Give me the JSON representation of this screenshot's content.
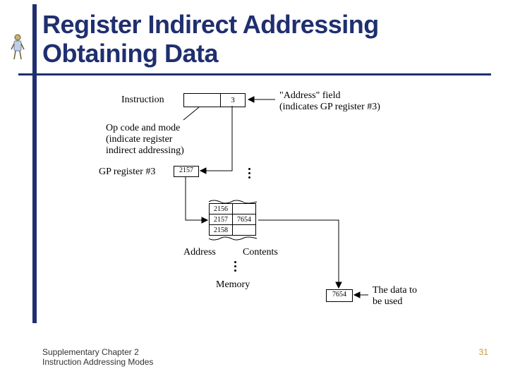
{
  "title_line1": "Register Indirect Addressing",
  "title_line2": "Obtaining Data",
  "footer": {
    "line1": "Supplementary Chapter 2",
    "line2": "Instruction Addressing Modes"
  },
  "page_number": "31",
  "diagram": {
    "instruction_label": "Instruction",
    "address_field_value": "3",
    "address_field_label1": "\"Address\" field",
    "address_field_label2": "(indicates GP register #3)",
    "opcode_label1": "Op code and mode",
    "opcode_label2": "(indicate register",
    "opcode_label3": "indirect addressing)",
    "gp_register_label": "GP register #3",
    "gp_register_value": "2157",
    "memory": {
      "rows": [
        {
          "addr": "2156",
          "val": ""
        },
        {
          "addr": "2157",
          "val": "7654"
        },
        {
          "addr": "2158",
          "val": ""
        }
      ],
      "addr_header": "Address",
      "contents_header": "Contents",
      "mem_label": "Memory"
    },
    "data_value": "7654",
    "data_label1": "The data to",
    "data_label2": "be used"
  }
}
